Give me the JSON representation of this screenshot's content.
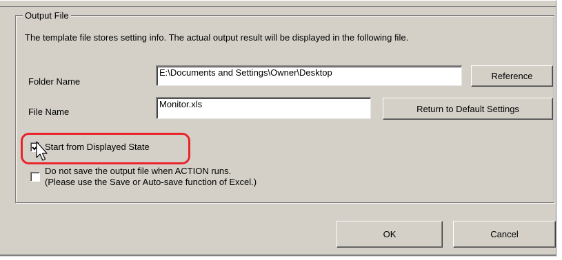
{
  "output_file_group": {
    "legend": "Output File",
    "description": "The template file stores setting info. The actual output result will be displayed in the following file."
  },
  "folder": {
    "label": "Folder Name",
    "value": "E:\\Documents and Settings\\Owner\\Desktop",
    "reference_button": "Reference"
  },
  "file": {
    "label": "File Name",
    "value": "Monitor.xls",
    "default_button": "Return to Default Settings"
  },
  "options": {
    "start_displayed": {
      "label": "Start from Displayed State",
      "checked": true
    },
    "no_save": {
      "label_line1": "Do not save the output file when ACTION runs.",
      "label_line2": "(Please use the Save or Auto-save function of Excel.)",
      "checked": false
    }
  },
  "footer": {
    "ok": "OK",
    "cancel": "Cancel"
  },
  "colors": {
    "highlight": "#e8242a",
    "dialog_bg": "#d4d0c8"
  },
  "icons": {
    "cursor": "mouse-pointer-icon",
    "check": "check-mark-icon"
  }
}
